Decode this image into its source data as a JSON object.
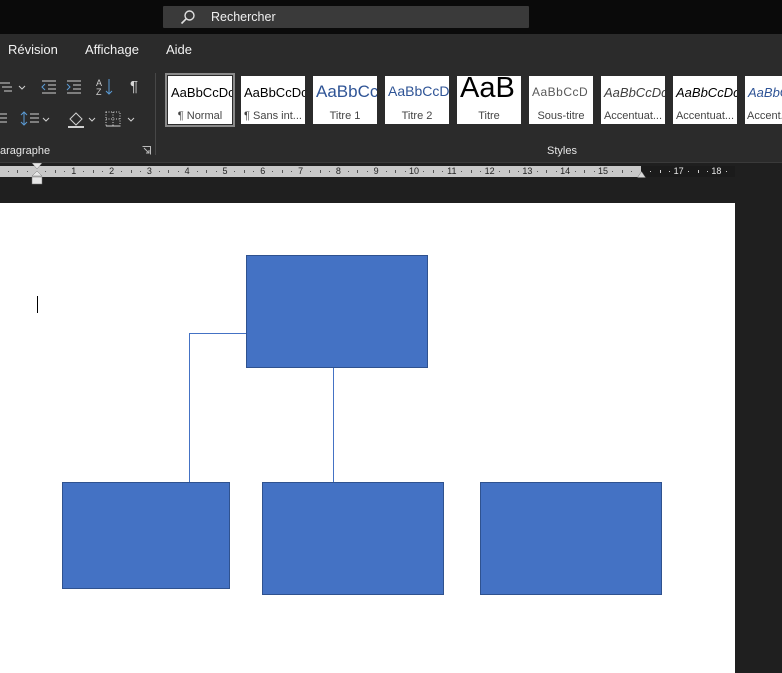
{
  "search": {
    "placeholder": "Rechercher",
    "icon": "search-icon"
  },
  "menu": {
    "items": [
      "Révision",
      "Affichage",
      "Aide"
    ]
  },
  "ribbon": {
    "paragraph_group_label": "aragraphe",
    "styles_group_label": "Styles",
    "styles": [
      {
        "preview": "AaBbCcDc",
        "name": "¶ Normal",
        "selected": true
      },
      {
        "preview": "AaBbCcDc",
        "name": "¶ Sans int..."
      },
      {
        "preview": "AaBbCc",
        "name": "Titre 1",
        "color": "#2f5496"
      },
      {
        "preview": "AaBbCcD",
        "name": "Titre 2",
        "color": "#2f5496"
      },
      {
        "preview": "AaB",
        "name": "Titre"
      },
      {
        "preview": "AaBbCcD",
        "name": "Sous-titre",
        "color": "#595959"
      },
      {
        "preview": "AaBbCcDc",
        "name": "Accentuat...",
        "color": "#404040"
      },
      {
        "preview": "AaBbCcDc",
        "name": "Accentuat...",
        "color": "#000000"
      },
      {
        "preview": "AaBbCcDc",
        "name": "Accent...",
        "color": "#2f5496"
      }
    ]
  },
  "ruler": {
    "numbers": [
      "1",
      "2",
      "3",
      "4",
      "5",
      "6",
      "7",
      "8",
      "9",
      "10",
      "11",
      "12",
      "13",
      "14",
      "15",
      "17",
      "18"
    ]
  },
  "colors": {
    "shape_fill": "#4472c4",
    "shape_border": "#2f528f"
  }
}
